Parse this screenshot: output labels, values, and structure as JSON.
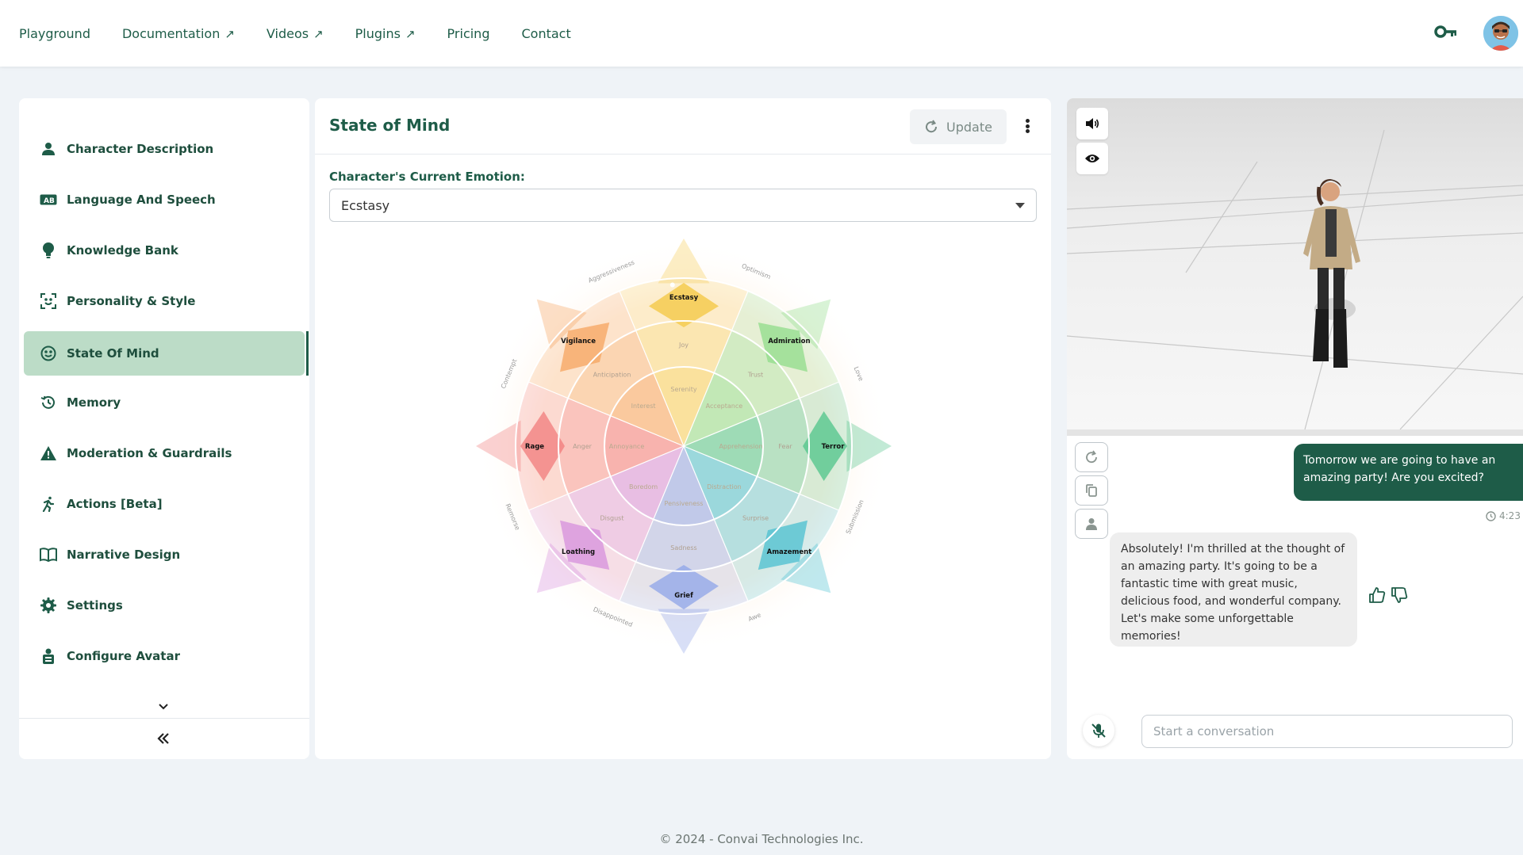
{
  "nav": {
    "links": [
      {
        "label": "Playground",
        "external": false
      },
      {
        "label": "Documentation",
        "external": true
      },
      {
        "label": "Videos",
        "external": true
      },
      {
        "label": "Plugins",
        "external": true
      },
      {
        "label": "Pricing",
        "external": false
      },
      {
        "label": "Contact",
        "external": false
      }
    ],
    "external_glyph": "↗",
    "icons": [
      "key-icon",
      "user-avatar"
    ]
  },
  "sidebar": {
    "items": [
      {
        "label": "Character Description",
        "icon": "person-icon"
      },
      {
        "label": "Language And Speech",
        "icon": "language-icon"
      },
      {
        "label": "Knowledge Bank",
        "icon": "lightbulb-icon"
      },
      {
        "label": "Personality & Style",
        "icon": "face-scan-icon"
      },
      {
        "label": "State Of Mind",
        "icon": "mood-icon",
        "active": true
      },
      {
        "label": "Memory",
        "icon": "history-icon"
      },
      {
        "label": "Moderation & Guardrails",
        "icon": "warning-icon"
      },
      {
        "label": "Actions [Beta]",
        "icon": "running-icon"
      },
      {
        "label": "Narrative Design",
        "icon": "book-icon"
      },
      {
        "label": "Settings",
        "icon": "gear-icon"
      },
      {
        "label": "Configure Avatar",
        "icon": "avatar-config-icon"
      }
    ],
    "collapse_glyph": "«"
  },
  "main": {
    "title": "State of Mind",
    "update_label": "Update",
    "emotion_label": "Character's Current Emotion:",
    "emotion_value": "Ecstasy",
    "wheel": {
      "selected": "Ecstasy",
      "outer_labels": [
        "Optimism",
        "Love",
        "Submission",
        "Awe",
        "Disappointed",
        "Remorse",
        "Contempt",
        "Aggressiveness"
      ],
      "petals": [
        {
          "name": "joy",
          "strong": "Ecstasy",
          "mid": "Joy",
          "mild": "Serenity",
          "color": "#f6cf5c"
        },
        {
          "name": "trust",
          "strong": "Admiration",
          "mid": "Trust",
          "mild": "Acceptance",
          "color": "#8fdc8a"
        },
        {
          "name": "fear",
          "strong": "Terror",
          "mid": "Fear",
          "mild": "Apprehension",
          "color": "#4fc48a"
        },
        {
          "name": "surprise",
          "strong": "Amazement",
          "mid": "Surprise",
          "mild": "Distraction",
          "color": "#49bfd0"
        },
        {
          "name": "sadness",
          "strong": "Grief",
          "mid": "Sadness",
          "mild": "Pensiveness",
          "color": "#8ea4e8"
        },
        {
          "name": "disgust",
          "strong": "Loathing",
          "mid": "Disgust",
          "mild": "Boredom",
          "color": "#d68fdc"
        },
        {
          "name": "anger",
          "strong": "Rage",
          "mid": "Anger",
          "mild": "Annoyance",
          "color": "#f27b7b"
        },
        {
          "name": "anticipation",
          "strong": "Vigilance",
          "mid": "Anticipation",
          "mild": "Interest",
          "color": "#f5a45f"
        }
      ]
    }
  },
  "chat": {
    "user_message": "Tomorrow we are going to have an amazing party! Are you excited?",
    "timestamp": "4:23",
    "bot_message": "Absolutely! I'm thrilled at the thought of an amazing party. It's going to be a fantastic time with great music, delicious food, and wonderful company. Let's make some unforgettable memories!",
    "input_placeholder": "Start a conversation"
  },
  "footer": {
    "text": "© 2024 - Convai Technologies Inc."
  },
  "colors": {
    "brand": "#1e5c48",
    "active_bg": "#bcdcc7",
    "page_bg": "#eff3f7"
  }
}
